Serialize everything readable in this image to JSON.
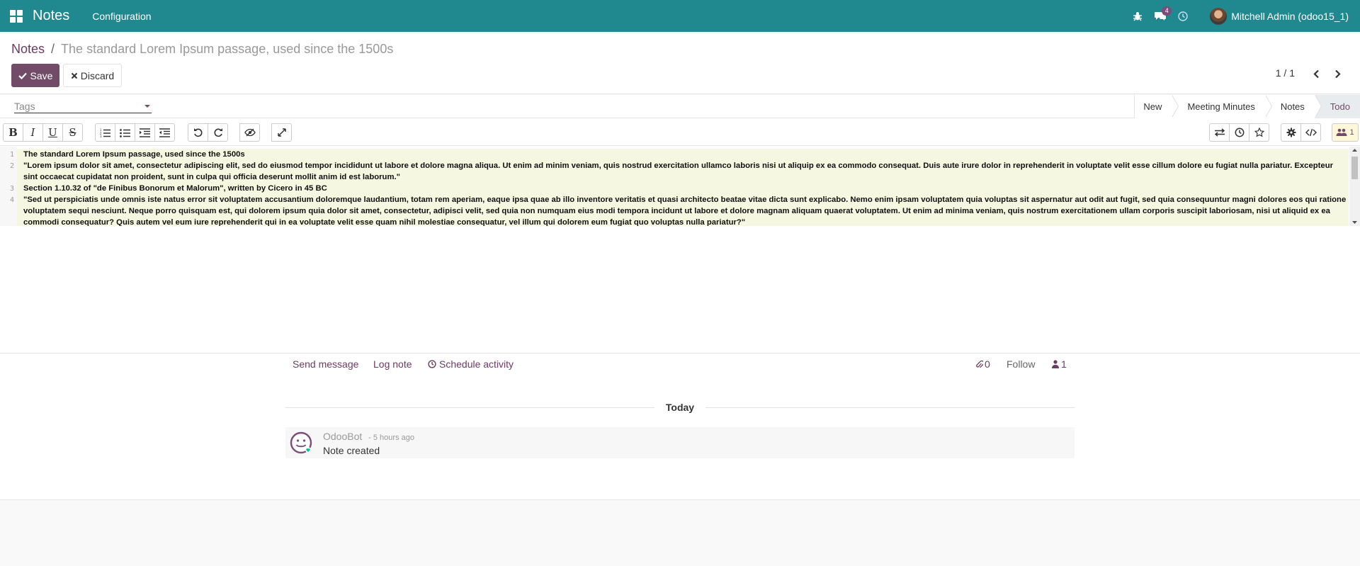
{
  "navbar": {
    "app_name": "Notes",
    "menu_configuration": "Configuration",
    "messages_count": "4",
    "user_name": "Mitchell Admin (odoo15_1)"
  },
  "breadcrumb": {
    "parent": "Notes",
    "separator": "/",
    "current": "The standard Lorem Ipsum passage, used since the 1500s"
  },
  "actions": {
    "save_label": "Save",
    "discard_label": "Discard"
  },
  "pager": {
    "value": "1 / 1"
  },
  "tags": {
    "placeholder": "Tags"
  },
  "stages": [
    {
      "label": "New",
      "active": false
    },
    {
      "label": "Meeting Minutes",
      "active": false
    },
    {
      "label": "Notes",
      "active": false
    },
    {
      "label": "Todo",
      "active": true
    }
  ],
  "toolbar": {
    "bold": "B",
    "italic": "I",
    "underline": "U",
    "strike": "S",
    "followers_count": "1"
  },
  "editor": {
    "lines": [
      {
        "num": "1",
        "text": "The standard Lorem Ipsum passage, used since the 1500s"
      },
      {
        "num": "2",
        "text": "\"Lorem ipsum dolor sit amet, consectetur adipiscing elit, sed do eiusmod tempor incididunt ut labore et dolore magna aliqua. Ut enim ad minim veniam, quis nostrud exercitation ullamco laboris nisi ut aliquip ex ea commodo consequat. Duis aute irure dolor in reprehenderit in voluptate velit esse cillum dolore eu fugiat nulla pariatur. Excepteur sint occaecat cupidatat non proident, sunt in culpa qui officia deserunt mollit anim id est laborum.\""
      },
      {
        "num": "3",
        "text": "Section 1.10.32 of \"de Finibus Bonorum et Malorum\", written by Cicero in 45 BC"
      },
      {
        "num": "4",
        "text": "\"Sed ut perspiciatis unde omnis iste natus error sit voluptatem accusantium doloremque laudantium, totam rem aperiam, eaque ipsa quae ab illo inventore veritatis et quasi architecto beatae vitae dicta sunt explicabo. Nemo enim ipsam voluptatem quia voluptas sit aspernatur aut odit aut fugit, sed quia consequuntur magni dolores eos qui ratione voluptatem sequi nesciunt. Neque porro quisquam est, qui dolorem ipsum quia dolor sit amet, consectetur, adipisci velit, sed quia non numquam eius modi tempora incidunt ut labore et dolore magnam aliquam quaerat voluptatem. Ut enim ad minima veniam, quis nostrum exercitationem ullam corporis suscipit laboriosam, nisi ut aliquid ex ea commodi consequatur? Quis autem vel eum iure reprehenderit qui in ea voluptate velit esse quam nihil molestiae consequatur, vel illum qui dolorem eum fugiat quo voluptas nulla pariatur?\""
      }
    ]
  },
  "chatter": {
    "send_message": "Send message",
    "log_note": "Log note",
    "schedule_activity": "Schedule activity",
    "attachments_count": "0",
    "follow": "Follow",
    "followers_count": "1",
    "date_separator": "Today",
    "messages": [
      {
        "author": "OdooBot",
        "date": "- 5 hours ago",
        "body": "Note created"
      }
    ]
  },
  "colors": {
    "navbar": "#208990",
    "primary": "#714b67"
  }
}
